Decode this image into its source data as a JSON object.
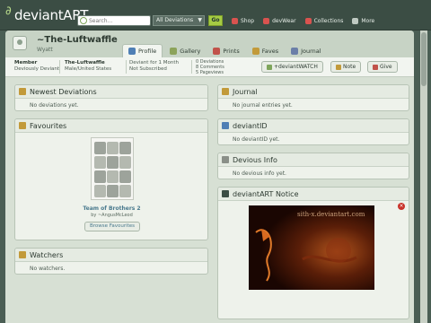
{
  "site": {
    "logo_text": "deviantART"
  },
  "search": {
    "placeholder": "Search...",
    "scope": "All Deviations",
    "go_label": "Go"
  },
  "topnav": [
    {
      "label": "Shop",
      "color": "#d9534f"
    },
    {
      "label": "devWear",
      "color": "#d9534f"
    },
    {
      "label": "Collections",
      "color": "#d9534f"
    },
    {
      "label": "More",
      "color": "#bfc9c2"
    }
  ],
  "profile": {
    "username": "~The-Luftwaffle",
    "realname": "Wyatt",
    "tabs": [
      {
        "label": "Profile",
        "active": true,
        "color": "#4f7fb5"
      },
      {
        "label": "Gallery",
        "active": false,
        "color": "#8ca35a"
      },
      {
        "label": "Prints",
        "active": false,
        "color": "#c1524a"
      },
      {
        "label": "Faves",
        "active": false,
        "color": "#c29a3a"
      },
      {
        "label": "Journal",
        "active": false,
        "color": "#6b7fa8"
      }
    ]
  },
  "info": {
    "member_label": "Member",
    "member_value": "Deviously Deviant",
    "name_label": "The-Luftwaffle",
    "name_value": "Male/United States",
    "deviant_for": "Deviant for 1 Month",
    "subscription": "Not Subscribed",
    "deviations": "0 Deviations",
    "comments": "8 Comments",
    "pageviews": "5 Pageviews",
    "watch_label": "+deviantWATCH",
    "note_label": "Note",
    "give_label": "Give"
  },
  "panels": {
    "newest": {
      "title": "Newest Deviations",
      "body": "No deviations yet."
    },
    "journal": {
      "title": "Journal",
      "body": "No journal entries yet."
    },
    "deviantid": {
      "title": "deviantID",
      "body": "No deviantID yet."
    },
    "devious": {
      "title": "Devious Info",
      "body": "No devious info yet."
    },
    "favourites": {
      "title": "Favourites",
      "item_title": "Team of Brothers 2",
      "item_by": "by ~AngusMcLeod",
      "browse_label": "Browse Favourites"
    },
    "notice": {
      "title": "deviantART Notice",
      "image_caption": "sith-x.deviantart.com"
    },
    "watchers": {
      "title": "Watchers",
      "body": "No watchers."
    }
  }
}
